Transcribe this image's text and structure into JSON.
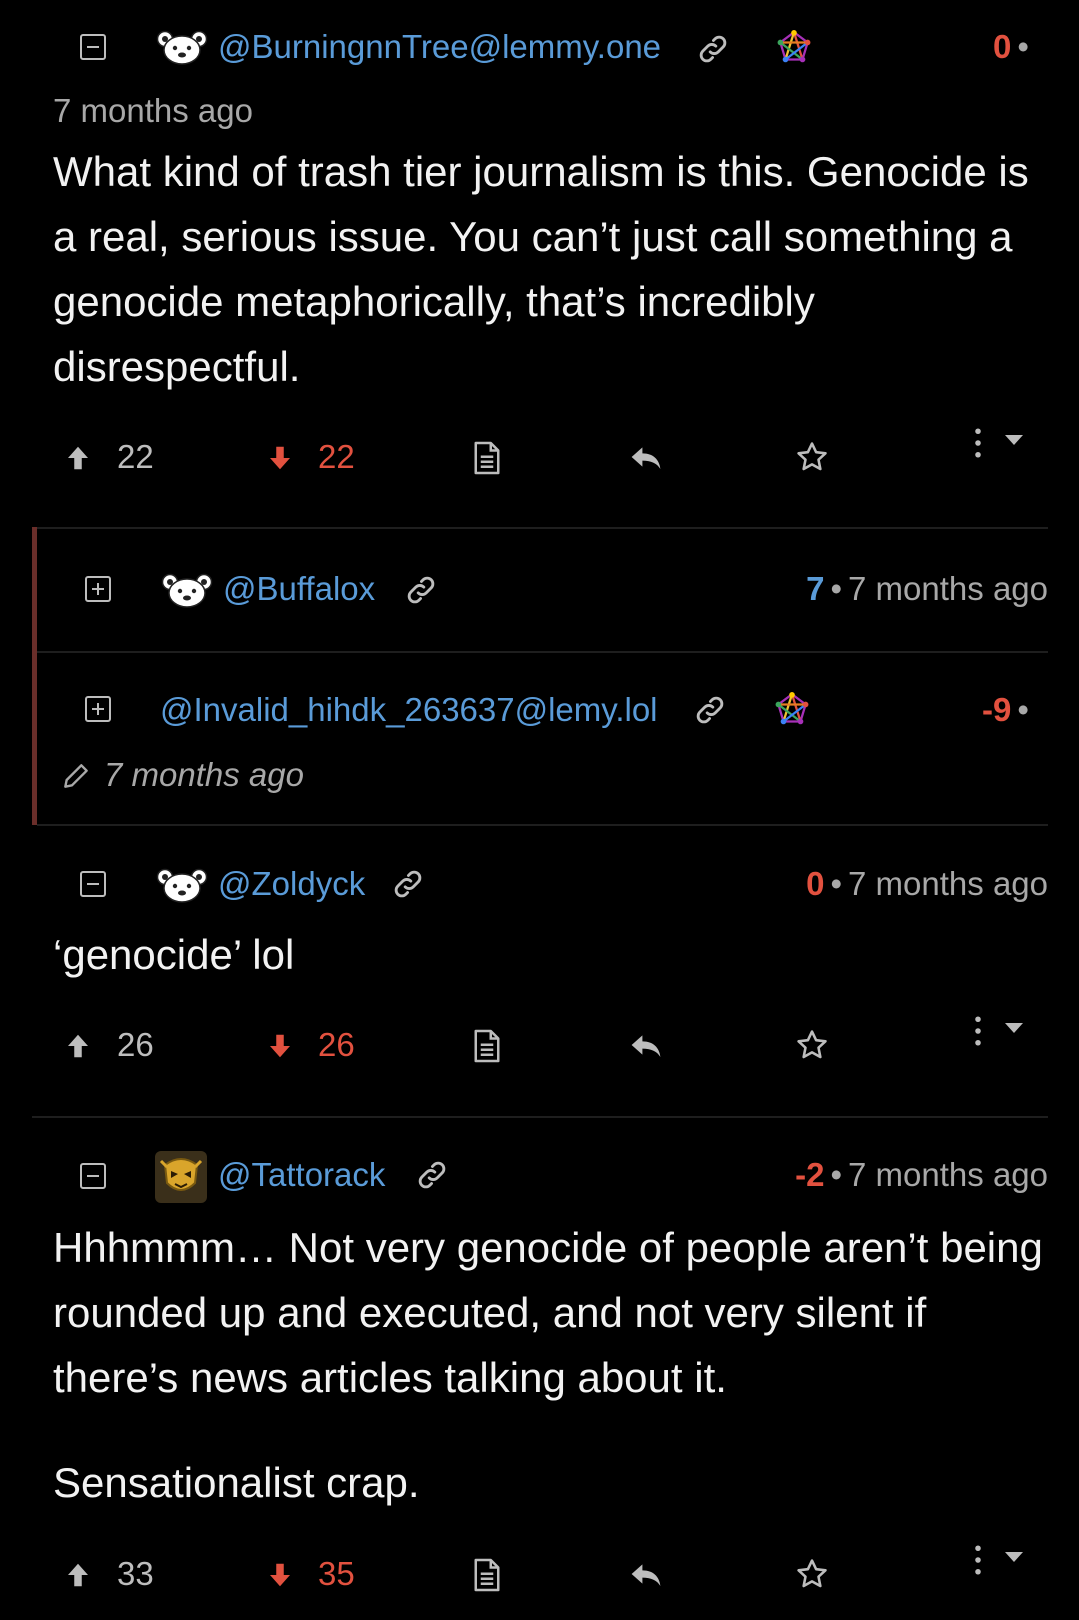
{
  "comments": [
    {
      "username": "@BurningnnTree@lemmy.one",
      "score": "0",
      "time": "7 months ago",
      "body": [
        "What kind of trash tier journalism is this. Genocide is a real, serious issue. You can’t just call something a genocide metaphorically, that’s incredibly disrespectful."
      ],
      "upvotes": "22",
      "downvotes": "22"
    },
    {
      "username": "@Buffalox",
      "score": "7",
      "time": "7 months ago"
    },
    {
      "username": "@Invalid_hihdk_263637@lemy.lol",
      "score": "-9",
      "time": "7 months ago"
    },
    {
      "username": "@Zoldyck",
      "score": "0",
      "time": "7 months ago",
      "body": [
        "‘genocide’ lol"
      ],
      "upvotes": "26",
      "downvotes": "26"
    },
    {
      "username": "@Tattorack",
      "score": "-2",
      "time": "7 months ago",
      "body": [
        "Hhhmmm… Not very genocide of people aren’t being rounded up and executed, and not very silent if there’s news articles talking about it.",
        "Sensationalist crap."
      ],
      "upvotes": "33",
      "downvotes": "35"
    }
  ],
  "separator": "•",
  "icons": {
    "collapse": "minus-square-icon",
    "expand": "plus-square-icon",
    "avatar_default": "bear-avatar-icon",
    "avatar_custom": "gold-mask-avatar",
    "link": "link-icon",
    "federation": "fediverse-pentagram-icon",
    "edited": "pencil-icon",
    "upvote": "arrow-up-icon",
    "downvote": "arrow-down-icon",
    "source": "document-icon",
    "reply": "reply-icon",
    "save": "star-icon",
    "more": "kebab-menu-icon",
    "dropdown": "caret-down-icon"
  },
  "colors": {
    "background": "#000000",
    "username": "#5a9bd8",
    "negative": "#e2513f",
    "muted": "#a8a8a8",
    "thread_bar": "#6a2e2a"
  }
}
